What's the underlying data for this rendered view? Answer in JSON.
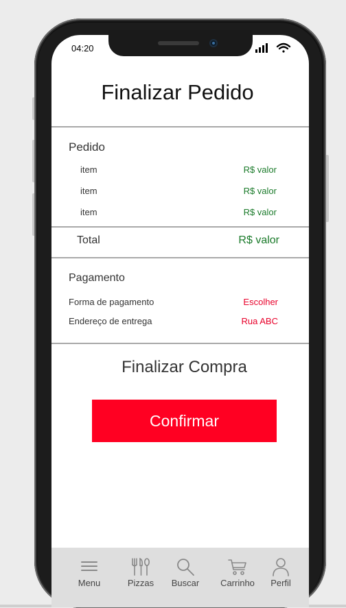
{
  "status_bar": {
    "time": "04:20"
  },
  "header": {
    "title": "Finalizar Pedido"
  },
  "order": {
    "section_title": "Pedido",
    "items": [
      {
        "label": "item",
        "value": "R$ valor"
      },
      {
        "label": "item",
        "value": "R$ valor"
      },
      {
        "label": "item",
        "value": "R$ valor"
      }
    ],
    "total_label": "Total",
    "total_value": "R$ valor"
  },
  "payment": {
    "section_title": "Pagamento",
    "method_label": "Forma de pagamento",
    "method_value": "Escolher",
    "address_label": "Endereço de entrega",
    "address_value": "Rua ABC"
  },
  "checkout": {
    "title": "Finalizar Compra",
    "confirm_label": "Confirmar"
  },
  "tabbar": {
    "items": [
      {
        "label": "Menu",
        "icon": "menu-icon"
      },
      {
        "label": "Pizzas",
        "icon": "cutlery-icon"
      },
      {
        "label": "Buscar",
        "icon": "search-icon"
      },
      {
        "label": "Carrinho",
        "icon": "cart-icon"
      },
      {
        "label": "Perfil",
        "icon": "user-icon"
      }
    ]
  },
  "colors": {
    "accent": "#ff0022",
    "price_green": "#1a7a2a",
    "link_red": "#e8002a"
  }
}
